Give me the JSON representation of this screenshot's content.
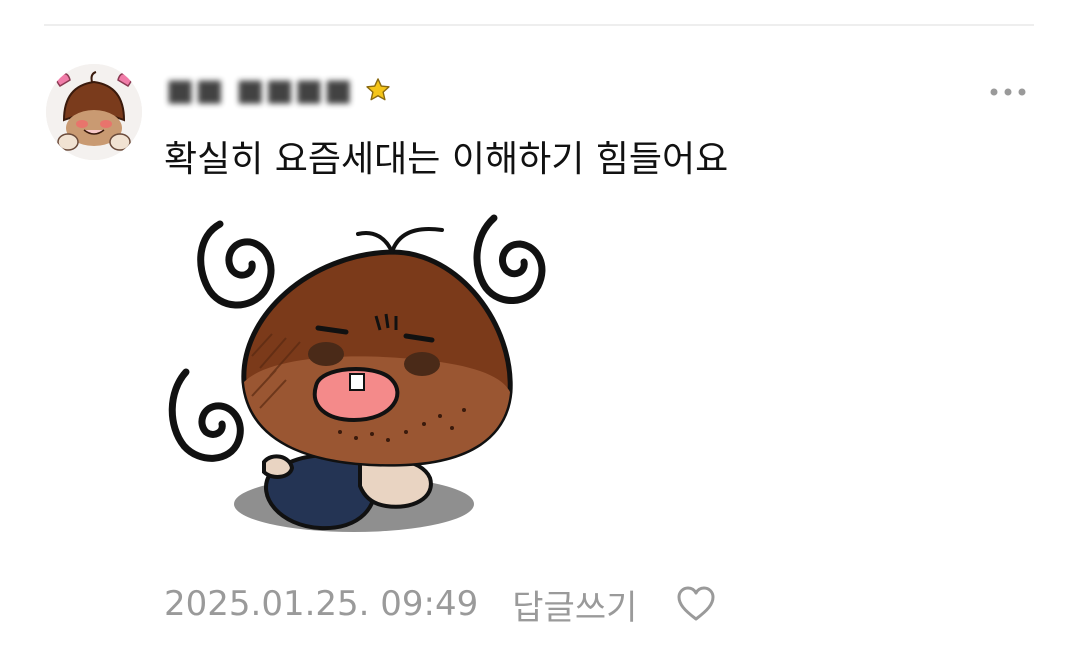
{
  "comment": {
    "author_name": "■■ ■■■■",
    "text": "확실히 요즘세대는 이해하기 힘들어요",
    "timestamp": "2025.01.25. 09:49",
    "reply_label": "답글쓰기"
  },
  "icons": {
    "badge": "star-icon",
    "more": "more-options-icon",
    "like": "heart-outline-icon"
  },
  "colors": {
    "star": "#f5c518",
    "meta_text": "#9a9a9a",
    "chestnut": "#7a3b1c",
    "heart": "#e85d8a"
  }
}
